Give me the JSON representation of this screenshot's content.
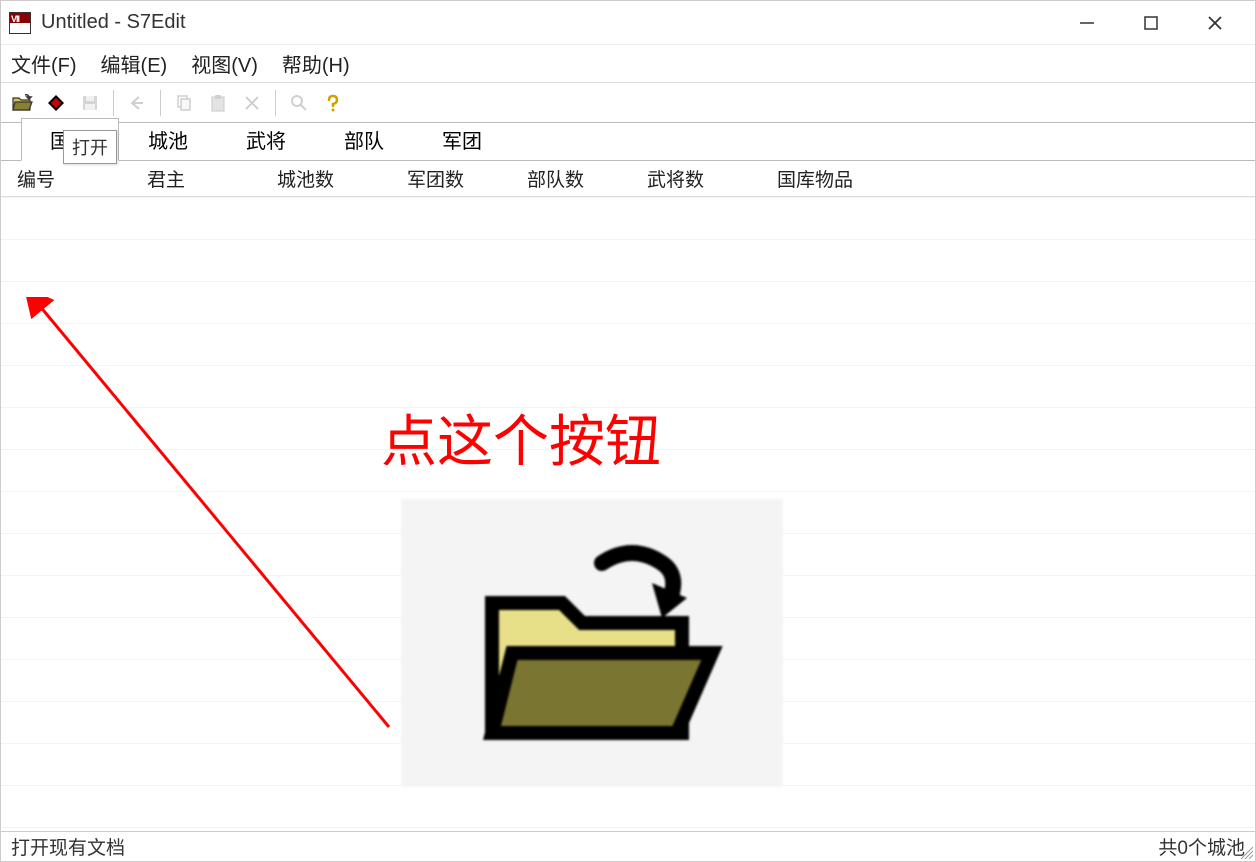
{
  "titlebar": {
    "title": "Untitled - S7Edit"
  },
  "menubar": {
    "file": "文件(F)",
    "edit": "编辑(E)",
    "view": "视图(V)",
    "help": "帮助(H)"
  },
  "toolbar": {
    "open_tooltip": "打开"
  },
  "tabs": {
    "items": [
      "国家",
      "城池",
      "武将",
      "部队",
      "军团"
    ]
  },
  "columns": [
    "编号",
    "君主",
    "城池数",
    "军团数",
    "部队数",
    "武将数",
    "国库物品"
  ],
  "annotation": {
    "text": "点这个按钮"
  },
  "statusbar": {
    "left": "打开现有文档",
    "right": "共0个城池"
  }
}
